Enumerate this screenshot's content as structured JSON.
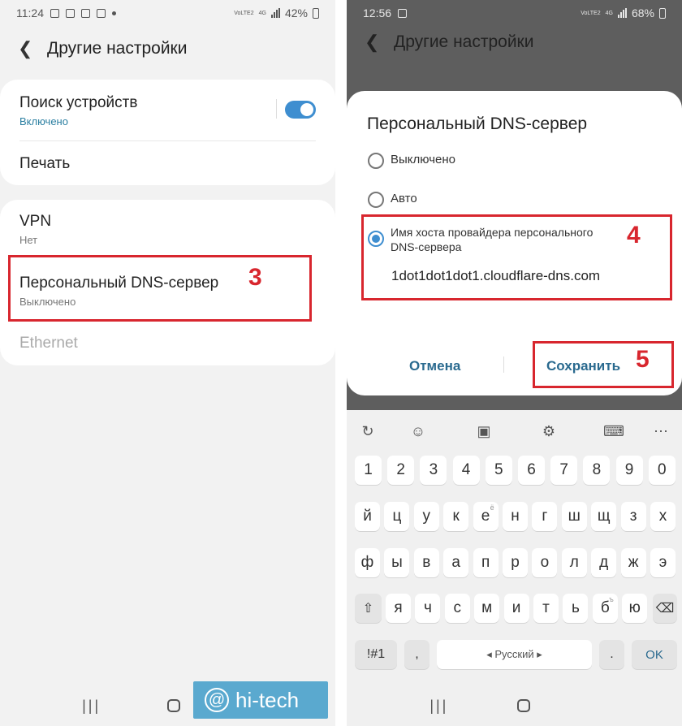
{
  "left": {
    "status_time": "11:24",
    "status_battery": "42%",
    "status_net": "VoLTE2",
    "status_4g": "4G",
    "title": "Другие настройки",
    "rows": {
      "device_search_title": "Поиск устройств",
      "device_search_sub": "Включено",
      "print_title": "Печать",
      "vpn_title": "VPN",
      "vpn_sub": "Нет",
      "dns_title": "Персональный DNS-сервер",
      "dns_sub": "Выключено",
      "ethernet_title": "Ethernet"
    },
    "device_search_enabled": true,
    "step_number": "3"
  },
  "right": {
    "status_time": "12:56",
    "status_battery": "68%",
    "status_net": "VoLTE2",
    "status_4g": "4G",
    "bg_title": "Другие настройки",
    "dialog": {
      "title": "Персональный DNS-сервер",
      "options": [
        "Выключено",
        "Авто",
        "Имя хоста провайдера персонального DNS-сервера"
      ],
      "selected_index": 2,
      "hostname": "1dot1dot1dot1.cloudflare-dns.com",
      "cancel": "Отмена",
      "save": "Сохранить"
    },
    "step4": "4",
    "step5": "5",
    "keyboard": {
      "numbers": [
        "1",
        "2",
        "3",
        "4",
        "5",
        "6",
        "7",
        "8",
        "9",
        "0"
      ],
      "row1": [
        "й",
        "ц",
        "у",
        "к",
        "е",
        "н",
        "г",
        "ш",
        "щ",
        "з",
        "х"
      ],
      "row1_hint": "ё",
      "row2": [
        "ф",
        "ы",
        "в",
        "а",
        "п",
        "р",
        "о",
        "л",
        "д",
        "ж",
        "э"
      ],
      "row3": [
        "я",
        "ч",
        "с",
        "м",
        "и",
        "т",
        "ь",
        "б",
        "ю"
      ],
      "row3_hint": "ъ",
      "sym": "!#1",
      "comma": ",",
      "space": "Русский",
      "dot": ".",
      "ok": "OK"
    },
    "watermark": "hi-tech"
  },
  "colors": {
    "accent": "#3e8ed0",
    "highlight": "#d8262e",
    "link": "#2a6a8f"
  }
}
